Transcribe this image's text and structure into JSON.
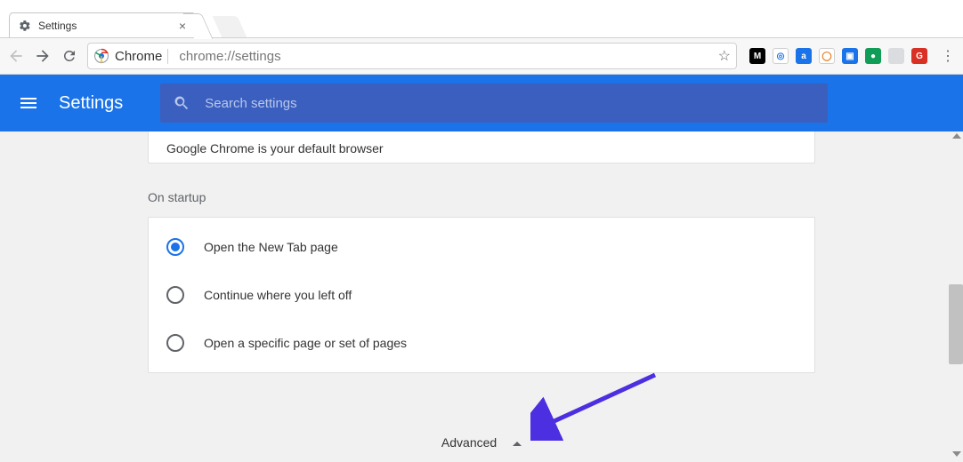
{
  "window": {
    "tab_title": "Settings"
  },
  "toolbar": {
    "origin_label": "Chrome",
    "url": "chrome://settings"
  },
  "extensions": [
    {
      "bg": "#000000",
      "letter": "M"
    },
    {
      "bg": "#ffffff",
      "letter": "◎",
      "fg": "#1a73e8",
      "ring": true
    },
    {
      "bg": "#1a73e8",
      "letter": "a"
    },
    {
      "bg": "#ffffff",
      "letter": "◯",
      "fg": "#e8710a",
      "ring": true
    },
    {
      "bg": "#1a73e8",
      "letter": "▣"
    },
    {
      "bg": "#0f9d58",
      "letter": "●"
    },
    {
      "bg": "#dadce0",
      "letter": " "
    },
    {
      "bg": "#d93025",
      "letter": "G"
    }
  ],
  "settings_header": {
    "title": "Settings",
    "search_placeholder": "Search settings"
  },
  "default_browser": {
    "text": "Google Chrome is your default browser"
  },
  "sections": {
    "on_startup_label": "On startup"
  },
  "startup_options": [
    {
      "label": "Open the New Tab page",
      "selected": true
    },
    {
      "label": "Continue where you left off",
      "selected": false
    },
    {
      "label": "Open a specific page or set of pages",
      "selected": false
    }
  ],
  "advanced": {
    "label": "Advanced"
  }
}
